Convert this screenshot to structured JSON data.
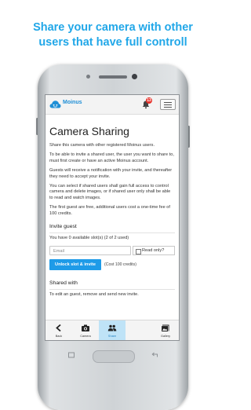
{
  "headline": {
    "line1": "Share your camera with other",
    "line2": "users that have full controll"
  },
  "appbar": {
    "logo_text": "Moinus",
    "notification_count": "13"
  },
  "page": {
    "title": "Camera Sharing",
    "paragraphs": [
      "Share this camera with other registered Moinus users.",
      "To be able to invite a shared user, the user you want to share to, must first create or have an active Moinus account.",
      "Guests will receive a notification with your invite, and thereafter they need to accept your invite.",
      "You can select if shared users shall gain full access to control camera and delete images, or if shared user only shall be able to read and watch images.",
      "The first guest are free, additional users cost a one-time fee of 100 credits."
    ]
  },
  "invite": {
    "title": "Invite guest",
    "slots_text": "You have 0 available slot(s) (2 of 2 used)",
    "email_placeholder": "Email",
    "readonly_label": "Read only?",
    "unlock_label": "Unlock slot & invite",
    "cost_text": "(Cost 100 credits)"
  },
  "shared": {
    "title": "Shared with",
    "text": "To edit an guest, remove and send new invite."
  },
  "nav": [
    {
      "label": "Back",
      "icon": "back-icon"
    },
    {
      "label": "Camera",
      "icon": "camera-icon"
    },
    {
      "label": "Share",
      "icon": "share-users-icon",
      "active": true
    },
    {
      "label": "Gallery",
      "icon": "gallery-icon"
    }
  ],
  "colors": {
    "accent": "#21a7e8",
    "button": "#1e9be8",
    "badge": "#e8332c",
    "active_tab": "#bfe3f7"
  }
}
